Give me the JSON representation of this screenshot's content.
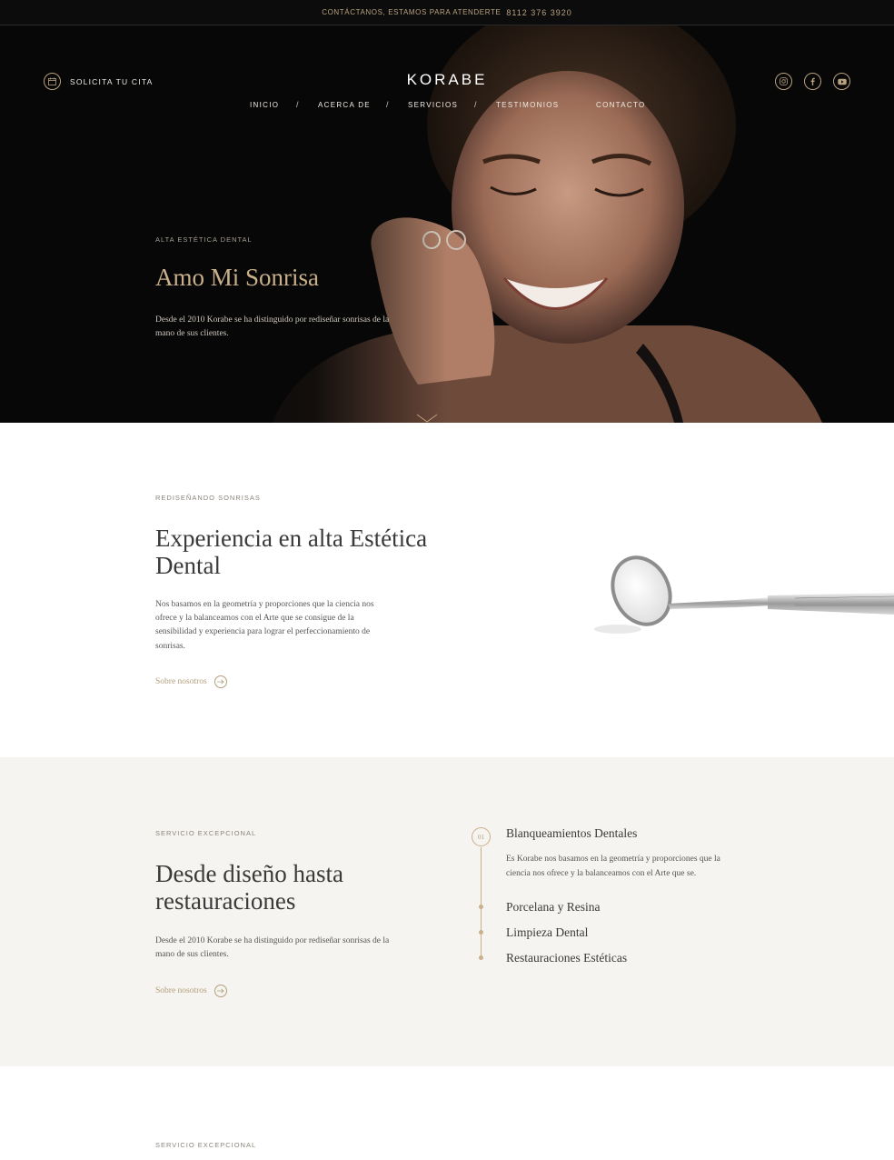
{
  "topbar": {
    "contact_text": "CONTÁCTANOS, ESTAMOS PARA ATENDERTE",
    "phone": "8112 376 3920"
  },
  "header": {
    "cta_label": "SOLICITA TU CITA",
    "logo": "KORABE",
    "nav": [
      "INICIO",
      "ACERCA DE",
      "SERVICIOS",
      "TESTIMONIOS",
      "CONTACTO"
    ],
    "nav_separator": "/",
    "socials": [
      "instagram-icon",
      "facebook-icon",
      "youtube-icon"
    ]
  },
  "hero": {
    "eyebrow": "ALTA ESTÉTICA DENTAL",
    "title": "Amo Mi Sonrisa",
    "text": "Desde el 2010 Korabe se ha distinguido por rediseñar sonrisas de la mano de sus clientes."
  },
  "about": {
    "eyebrow": "REDISEÑANDO SONRISAS",
    "title": "Experiencia en alta Estética Dental",
    "text": "Nos basamos en la geometría y proporciones que la ciencia nos ofrece y la balanceamos con el Arte que se consigue de la sensibilidad y experiencia para lograr el perfeccionamiento de sonrisas.",
    "link": "Sobre nosotros"
  },
  "services": {
    "eyebrow": "SERVICIO EXCEPCIONAL",
    "title": "Desde diseño hasta restauraciones",
    "text": "Desde el 2010 Korabe se ha distinguido por rediseñar sonrisas de la mano de sus clientes.",
    "link": "Sobre nosotros",
    "active_number": "01",
    "items": [
      {
        "title": "Blanqueamientos Dentales",
        "desc": "Es Korabe nos basamos en la geometría y proporciones que la ciencia nos ofrece y la balanceamos con el Arte que se."
      },
      {
        "title": "Porcelana y Resina"
      },
      {
        "title": "Limpieza Dental"
      },
      {
        "title": "Restauraciones Estéticas"
      }
    ]
  },
  "next_section": {
    "eyebrow": "SERVICIO EXCEPCIONAL"
  },
  "colors": {
    "accent": "#c9b08a",
    "dark": "#0c0c0c",
    "light_bg": "#f6f4f0"
  }
}
